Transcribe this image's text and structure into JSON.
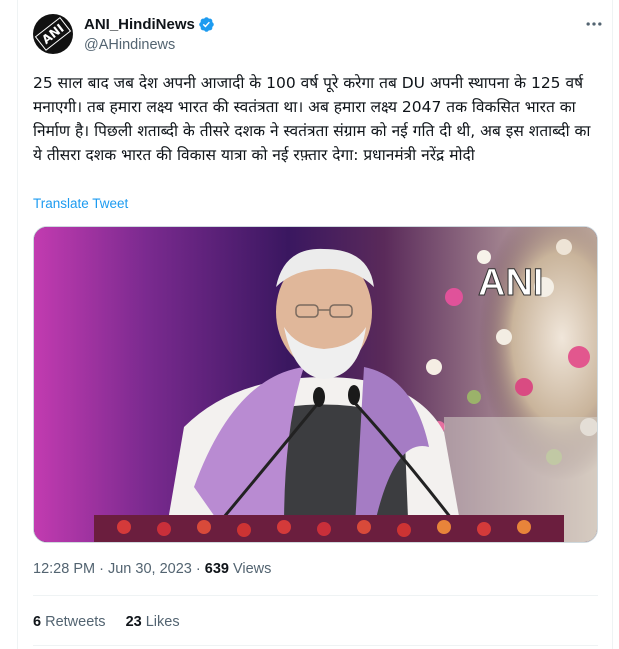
{
  "author": {
    "name": "ANI_HindiNews",
    "handle": "@AHindinews",
    "avatar_text": "ANI"
  },
  "more_icon": "more-horizontal-icon",
  "tweet": {
    "text": "25 साल बाद जब देश अपनी आजादी के 100 वर्ष पूरे करेगा तब DU अपनी स्थापना के 125 वर्ष मनाएगी। तब हमारा लक्ष्य भारत की स्वतंत्रता था। अब हमारा लक्ष्य 2047 तक विकसित भारत का निर्माण है। पिछली शताब्दी के तीसरे दशक ने स्वतंत्रता संग्राम को नई गति दी थी, अब इस शताब्दी का ये तीसरा दशक भारत की विकास यात्रा को नई रफ़्तार देगा: प्रधानमंत्री नरेंद्र मोदी",
    "translate_label": "Translate Tweet",
    "media_watermark": "ANI"
  },
  "meta": {
    "time": "12:28 PM",
    "separator": "·",
    "date": "Jun 30, 2023",
    "views_count": "639",
    "views_label": "Views"
  },
  "stats": {
    "retweets_count": "6",
    "retweets_label": "Retweets",
    "likes_count": "23",
    "likes_label": "Likes"
  },
  "colors": {
    "link": "#1d9bf0",
    "secondary_text": "#536471",
    "verified": "#1d9bf0"
  }
}
